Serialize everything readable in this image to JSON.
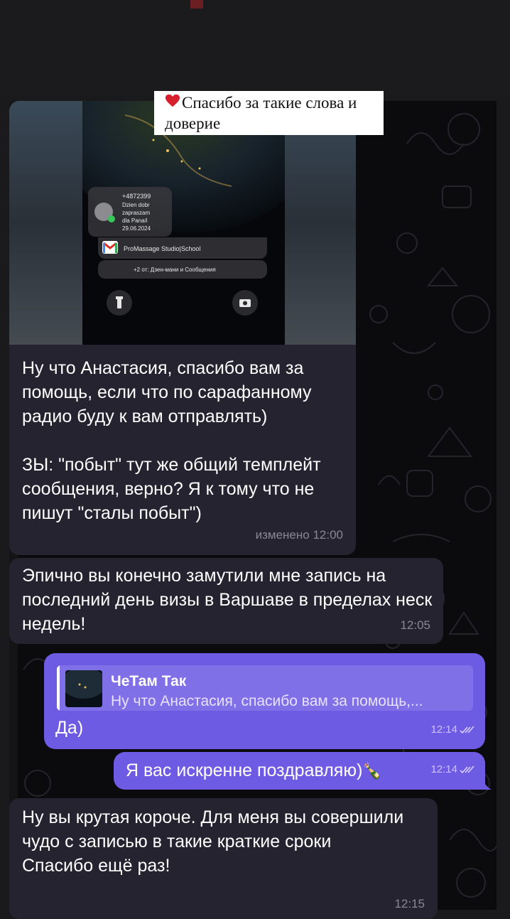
{
  "photo_message": {
    "notification_number": "+4872399",
    "notification_lines": [
      "Dzien dobr",
      "zapraszam",
      "dla Pana/i",
      "29.06.2024"
    ],
    "mail_sender": "ProMassage Studio|School",
    "more_notifications": "+2 от: Дзен-мани и Сообщения",
    "sticker_caption": "Спасибо за такие слова и доверие"
  },
  "messages": [
    {
      "text": "Ну что Анастасия, спасибо вам за помощь, если что по сарафанному радио буду к вам отправлять)\n\nЗЫ: \"побыт\" тут же общий темплейт сообщения, верно? Я к тому что не пишут \"сталы побыт\")",
      "meta": "изменено 12:00"
    },
    {
      "text": "Эпично вы конечно замутили мне запись на последний день визы в Варшаве в пределах неск недель!",
      "meta": "12:05"
    },
    {
      "reply_name": "ЧеТам Так",
      "reply_snippet": "Ну что Анастасия, спасибо вам за помощь,...",
      "text": "Да)",
      "meta": "12:14"
    },
    {
      "text": "Я вас искренне поздравляю)",
      "emoji": "🍾",
      "meta": "12:14"
    },
    {
      "text": "Ну вы крутая короче. Для меня вы совершили чудо с записью в такие краткие сроки\nСпасибо ещё раз!",
      "meta": "12:15"
    }
  ],
  "colors": {
    "incoming_bubble": "#262331",
    "outgoing_bubble": "#6e5be4",
    "background": "#0b0b0d"
  }
}
